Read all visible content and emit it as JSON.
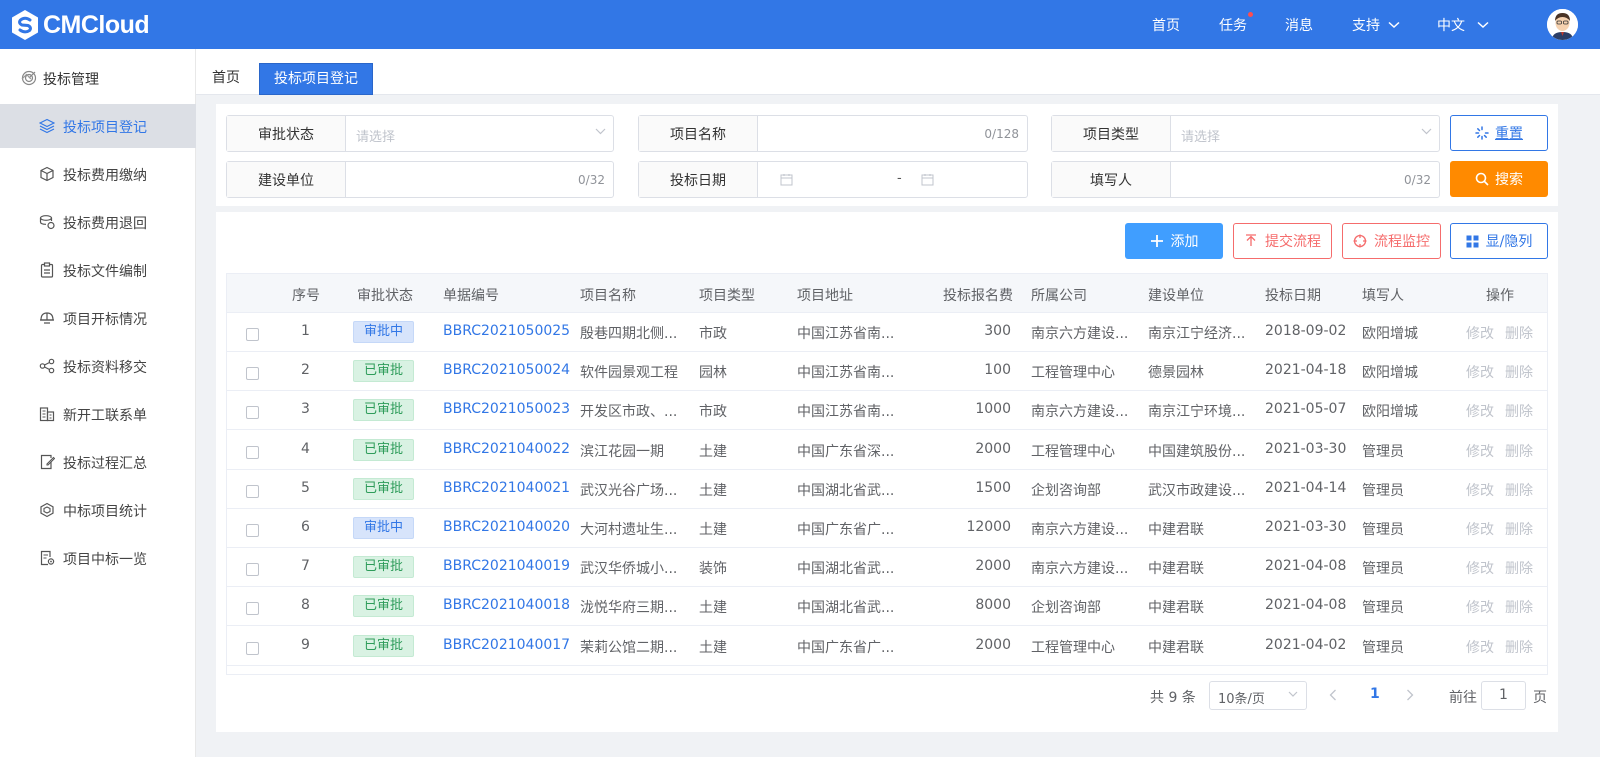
{
  "header": {
    "logo_text": "CMCloud",
    "nav": [
      {
        "label": "首页",
        "dot": false
      },
      {
        "label": "任务",
        "dot": true
      },
      {
        "label": "消息",
        "dot": false
      },
      {
        "label": "支持",
        "dot": false
      },
      {
        "label": "中文",
        "dot": false
      }
    ],
    "colors": {
      "primary": "#3277e6",
      "warning": "#ff8a00",
      "danger": "#f56c6c"
    }
  },
  "sidebar": {
    "group_label": "投标管理",
    "items": [
      {
        "label": "投标项目登记",
        "icon": "layers-icon",
        "active": true
      },
      {
        "label": "投标费用缴纳",
        "icon": "cube-icon"
      },
      {
        "label": "投标费用退回",
        "icon": "coins-icon"
      },
      {
        "label": "投标文件编制",
        "icon": "clipboard-icon"
      },
      {
        "label": "项目开标情况",
        "icon": "helmet-icon"
      },
      {
        "label": "投标资料移交",
        "icon": "share-icon"
      },
      {
        "label": "新开工联系单",
        "icon": "building-icon"
      },
      {
        "label": "投标过程汇总",
        "icon": "document-edit-icon"
      },
      {
        "label": "中标项目统计",
        "icon": "hexagon-icon"
      },
      {
        "label": "项目中标一览",
        "icon": "file-gear-icon"
      }
    ]
  },
  "tabs": {
    "home": "首页",
    "active": "投标项目登记"
  },
  "filters": {
    "status": {
      "label": "审批状态",
      "placeholder": "请选择"
    },
    "project_name": {
      "label": "项目名称",
      "counter": "0/128"
    },
    "project_type": {
      "label": "项目类型",
      "placeholder": "请选择"
    },
    "builder": {
      "label": "建设单位",
      "counter": "0/32"
    },
    "bid_date": {
      "label": "投标日期",
      "separator": "-"
    },
    "filler": {
      "label": "填写人",
      "counter": "0/32"
    },
    "reset_label": "重置",
    "search_label": "搜索"
  },
  "actions": {
    "add": "添加",
    "submit": "提交流程",
    "monitor": "流程监控",
    "columns": "显/隐列"
  },
  "table": {
    "headers": [
      "序号",
      "审批状态",
      "单据编号",
      "项目名称",
      "项目类型",
      "项目地址",
      "投标报名费",
      "所属公司",
      "建设单位",
      "投标日期",
      "填写人",
      "操作"
    ],
    "edit_label": "修改",
    "delete_label": "删除",
    "rows": [
      {
        "no": "1",
        "status": "审批中",
        "code": "BBRC2021050025",
        "name": "殷巷四期北侧...",
        "type": "市政",
        "addr": "中国江苏省南...",
        "fee": "300",
        "company": "南京六方建设...",
        "builder": "南京江宁经济...",
        "date": "2018-09-02",
        "filler": "欧阳增城"
      },
      {
        "no": "2",
        "status": "已审批",
        "code": "BBRC2021050024",
        "name": "软件园景观工程",
        "type": "园林",
        "addr": "中国江苏省南...",
        "fee": "100",
        "company": "工程管理中心",
        "builder": "德景园林",
        "date": "2021-04-18",
        "filler": "欧阳增城"
      },
      {
        "no": "3",
        "status": "已审批",
        "code": "BBRC2021050023",
        "name": "开发区市政、...",
        "type": "市政",
        "addr": "中国江苏省南...",
        "fee": "1000",
        "company": "南京六方建设...",
        "builder": "南京江宁环境...",
        "date": "2021-05-07",
        "filler": "欧阳增城"
      },
      {
        "no": "4",
        "status": "已审批",
        "code": "BBRC2021040022",
        "name": "滨江花园一期",
        "type": "土建",
        "addr": "中国广东省深...",
        "fee": "2000",
        "company": "工程管理中心",
        "builder": "中国建筑股份...",
        "date": "2021-03-30",
        "filler": "管理员"
      },
      {
        "no": "5",
        "status": "已审批",
        "code": "BBRC2021040021",
        "name": "武汉光谷广场...",
        "type": "土建",
        "addr": "中国湖北省武...",
        "fee": "1500",
        "company": "企划咨询部",
        "builder": "武汉市政建设...",
        "date": "2021-04-14",
        "filler": "管理员"
      },
      {
        "no": "6",
        "status": "审批中",
        "code": "BBRC2021040020",
        "name": "大河村遗址生...",
        "type": "土建",
        "addr": "中国广东省广...",
        "fee": "12000",
        "company": "南京六方建设...",
        "builder": "中建君联",
        "date": "2021-03-30",
        "filler": "管理员"
      },
      {
        "no": "7",
        "status": "已审批",
        "code": "BBRC2021040019",
        "name": "武汉华侨城小...",
        "type": "装饰",
        "addr": "中国湖北省武...",
        "fee": "2000",
        "company": "南京六方建设...",
        "builder": "中建君联",
        "date": "2021-04-08",
        "filler": "管理员"
      },
      {
        "no": "8",
        "status": "已审批",
        "code": "BBRC2021040018",
        "name": "泷悦华府三期...",
        "type": "土建",
        "addr": "中国湖北省武...",
        "fee": "8000",
        "company": "企划咨询部",
        "builder": "中建君联",
        "date": "2021-04-08",
        "filler": "管理员"
      },
      {
        "no": "9",
        "status": "已审批",
        "code": "BBRC2021040017",
        "name": "茉莉公馆二期...",
        "type": "土建",
        "addr": "中国广东省广...",
        "fee": "2000",
        "company": "工程管理中心",
        "builder": "中建君联",
        "date": "2021-04-02",
        "filler": "管理员"
      }
    ]
  },
  "pagination": {
    "total": "共 9 条",
    "page_size": "10条/页",
    "current": "1",
    "goto_prefix": "前往",
    "goto_value": "1",
    "goto_suffix": "页"
  }
}
